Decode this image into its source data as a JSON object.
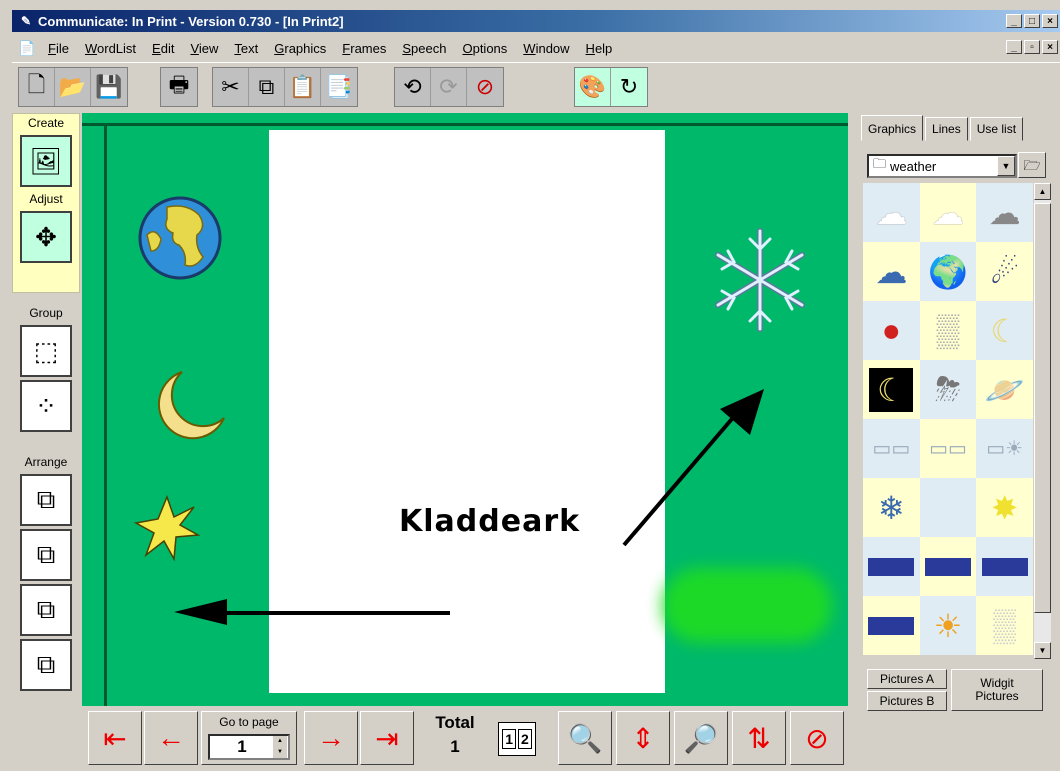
{
  "window": {
    "title": "Communicate: In Print - Version 0.730 - [In Print2]",
    "controls": [
      "_",
      "□",
      "×"
    ],
    "mdi_controls": [
      "_",
      "▫",
      "×"
    ]
  },
  "menu": [
    "File",
    "WordList",
    "Edit",
    "View",
    "Text",
    "Graphics",
    "Frames",
    "Speech",
    "Options",
    "Window",
    "Help"
  ],
  "toolbar": {
    "icons": [
      "new-document-icon",
      "open-folder-icon",
      "save-disk-icon",
      "print-icon",
      "cut-scissors-icon",
      "copy-icon",
      "paste-icon",
      "paste-special-icon",
      "undo-icon",
      "redo-icon",
      "no-speech-icon",
      "palette-icon",
      "refresh-icon"
    ]
  },
  "left_panel": {
    "create_label": "Create",
    "adjust_label": "Adjust",
    "group_label": "Group",
    "arrange_label": "Arrange"
  },
  "canvas": {
    "page_text": "Kladdeark",
    "items": [
      "earth-globe-icon",
      "crescent-moon-icon",
      "star-icon",
      "snowflake-icon"
    ],
    "colors": {
      "background": "#00b86a",
      "page": "#ffffff"
    }
  },
  "right_panel": {
    "tabs": [
      "Graphics",
      "Lines",
      "Use list"
    ],
    "active_tab": "Graphics",
    "folder": "weather",
    "buttons": {
      "pictures_a": "Pictures A",
      "pictures_b": "Pictures B",
      "widgit_line1": "Widgit",
      "widgit_line2": "Pictures"
    }
  },
  "bottom_bar": {
    "go_to_page_label": "Go to page",
    "page_value": "1",
    "total_label": "Total",
    "total_value": "1",
    "pages_view": [
      "1",
      "2"
    ]
  }
}
